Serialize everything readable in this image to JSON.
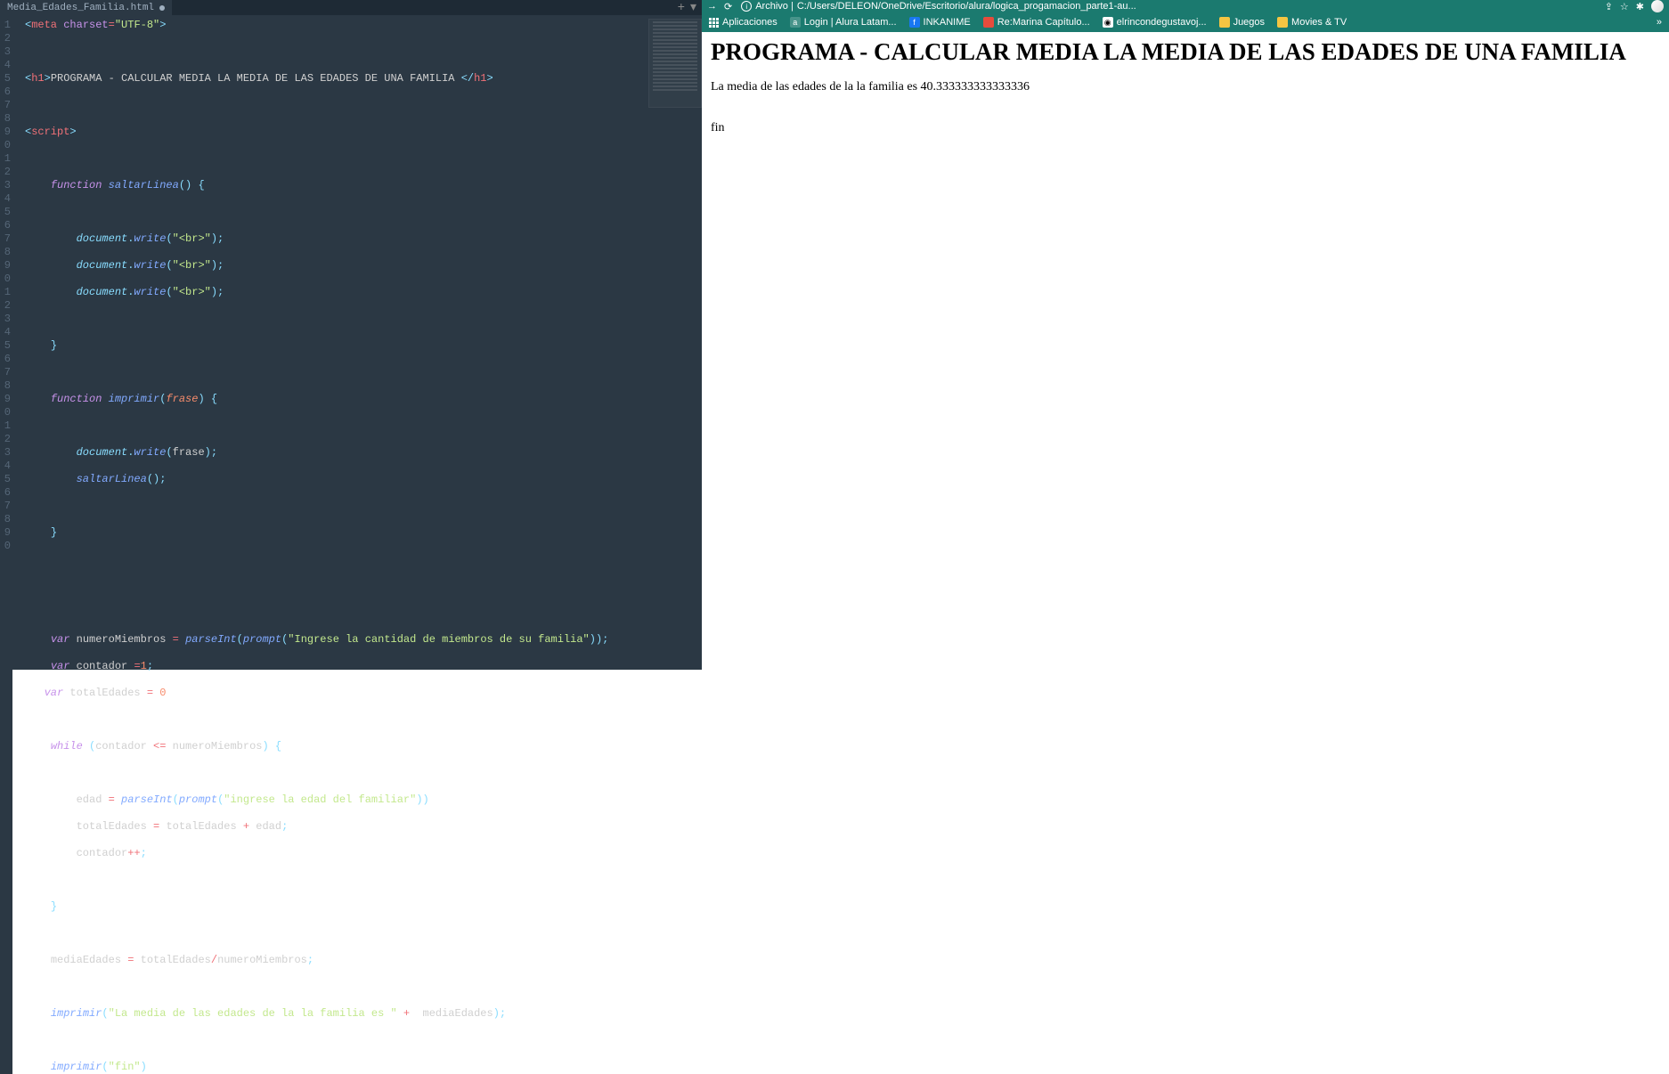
{
  "editor": {
    "tab_name": "Media_Edades_Familia.html",
    "tab_dirty": true,
    "lines": [
      "1",
      "2",
      "3",
      "4",
      "5",
      "6",
      "7",
      "8",
      "9",
      "0",
      "1",
      "2",
      "3",
      "4",
      "5",
      "6",
      "7",
      "8",
      "9",
      "0",
      "1",
      "2",
      "3",
      "4",
      "5",
      "6",
      "7",
      "8",
      "9",
      "0",
      "1",
      "2",
      "3",
      "4",
      "5",
      "6",
      "7",
      "8",
      "9",
      "0"
    ],
    "code": {
      "l1": {
        "tag_open": "<",
        "tag": "meta",
        "sp": " ",
        "attr": "charset",
        "eq": "=",
        "str": "\"UTF-8\"",
        "tag_close": ">"
      },
      "l3": {
        "tag_open": "<",
        "tag": "h1",
        "tag_close": ">",
        "text": "PROGRAMA - CALCULAR MEDIA LA MEDIA DE LAS EDADES DE UNA FAMILIA ",
        "ctag_open": "</",
        "ctag": "h1",
        "ctag_close": ">"
      },
      "l5": {
        "tag_open": "<",
        "tag": "script",
        "tag_close": ">"
      },
      "l7": {
        "kw": "function",
        "sp": " ",
        "fn": "saltarLinea",
        "paren": "() {"
      },
      "l9": {
        "obj": "document",
        "dot": ".",
        "fn": "write",
        "paren": "(",
        "str": "\"<br>\"",
        "pclose": ");"
      },
      "l10": {
        "obj": "document",
        "dot": ".",
        "fn": "write",
        "paren": "(",
        "str": "\"<br>\"",
        "pclose": ");"
      },
      "l11": {
        "obj": "document",
        "dot": ".",
        "fn": "write",
        "paren": "(",
        "str": "\"<br>\"",
        "pclose": ");"
      },
      "l13": {
        "brace": "}"
      },
      "l15": {
        "kw": "function",
        "sp": " ",
        "fn": "imprimir",
        "paren": "(",
        "param": "frase",
        "pclose": ") {"
      },
      "l17": {
        "obj": "document",
        "dot": ".",
        "fn": "write",
        "paren": "(",
        "arg": "frase",
        "pclose": ");"
      },
      "l18": {
        "fn": "saltarLinea",
        "paren": "();"
      },
      "l20": {
        "brace": "}"
      },
      "l24": {
        "kw": "var",
        "sp": " ",
        "name": "numeroMiembros ",
        "eq": "=",
        "sp2": " ",
        "fn": "parseInt",
        "paren": "(",
        "fn2": "prompt",
        "paren2": "(",
        "str": "\"Ingrese la cantidad de miembros de su familia\"",
        "pclose": "));"
      },
      "l25": {
        "kw": "var",
        "sp": " ",
        "name": "contador ",
        "eq": "=",
        "num": "1",
        "semi": ";"
      },
      "l26": {
        "kw": "var",
        "sp": " ",
        "name": "totalEdades ",
        "eq": "=",
        "sp2": " ",
        "num": "0"
      },
      "l28": {
        "kw": "while",
        "sp": " (",
        "name": "contador ",
        "op": "<=",
        "sp2": " ",
        "name2": "numeroMiembros",
        ") {": ") {"
      },
      "l30": {
        "name": "edad ",
        "eq": "=",
        "sp": " ",
        "fn": "parseInt",
        "paren": "(",
        "fn2": "prompt",
        "paren2": "(",
        "str": "\"ingrese la edad del familiar\"",
        "pclose": "))"
      },
      "l31": {
        "name": "totalEdades ",
        "eq": "=",
        "sp": " ",
        "name2": "totalEdades ",
        "op": "+",
        "sp2": " ",
        "name3": "edad",
        ";": ";"
      },
      "l32": {
        "name": "contador",
        "op": "++",
        ";": ";"
      },
      "l34": {
        "brace": "}"
      },
      "l36": {
        "name": "mediaEdades ",
        "eq": "=",
        "sp": " ",
        "name2": "totalEdades",
        "op": "/",
        "name3": "numeroMiembros",
        ";": ";"
      },
      "l38": {
        "fn": "imprimir",
        "paren": "(",
        "str": "\"La media de las edades de la la familia es \"",
        "sp": " ",
        "op": "+",
        "sp2": "  ",
        "name": "mediaEdades",
        ");": ");"
      },
      "l40": {
        "fn": "imprimir",
        "paren": "(",
        "str": "\"fin\"",
        "pclose": ")"
      }
    }
  },
  "browser": {
    "url_prefix": "Archivo | ",
    "url": "C:/Users/DELEON/OneDrive/Escritorio/alura/logica_progamacion_parte1-au...",
    "bookmarks": {
      "apps": "Aplicaciones",
      "login": "Login | Alura Latam...",
      "inkanime": "INKANIME",
      "remarina": "Re:Marina Capítulo...",
      "rincon": "elrincondegustavoj...",
      "juegos": "Juegos",
      "movies": "Movies & TV"
    },
    "page": {
      "h1": "PROGRAMA - CALCULAR MEDIA LA MEDIA DE LAS EDADES DE UNA FAMILIA ",
      "result": "La media de las edades de la la familia es 40.333333333333336",
      "fin": "fin"
    }
  }
}
